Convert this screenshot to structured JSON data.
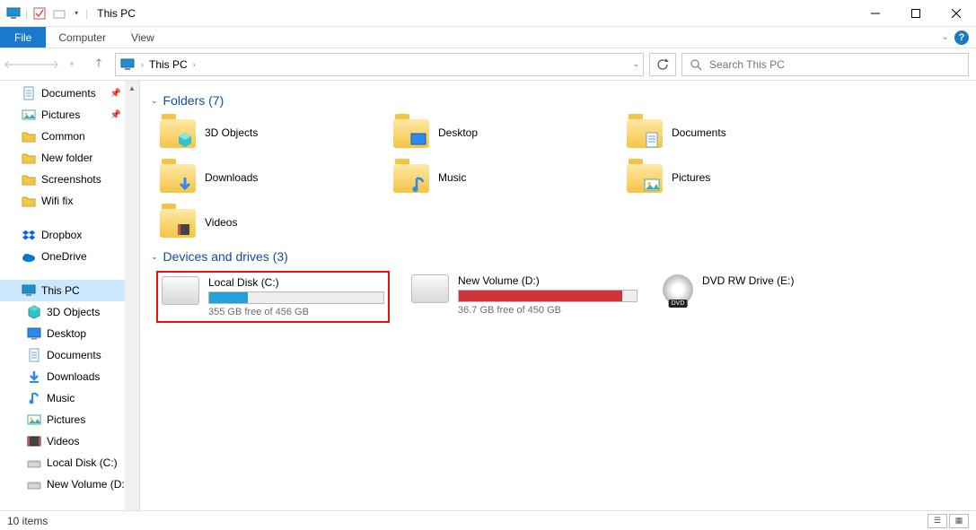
{
  "window": {
    "title": "This PC"
  },
  "ribbon": {
    "file": "File",
    "tabs": [
      "Computer",
      "View"
    ]
  },
  "address": {
    "location": "This PC"
  },
  "search": {
    "placeholder": "Search This PC"
  },
  "sidebar": {
    "quick": [
      {
        "label": "Documents",
        "pinned": true
      },
      {
        "label": "Pictures",
        "pinned": true
      },
      {
        "label": "Common",
        "pinned": false
      },
      {
        "label": "New folder",
        "pinned": false
      },
      {
        "label": "Screenshots",
        "pinned": false
      },
      {
        "label": "Wifi fix",
        "pinned": false
      }
    ],
    "cloud": [
      {
        "label": "Dropbox",
        "icon": "dropbox"
      },
      {
        "label": "OneDrive",
        "icon": "onedrive"
      }
    ],
    "thispc": {
      "label": "This PC"
    },
    "thispc_children": [
      "3D Objects",
      "Desktop",
      "Documents",
      "Downloads",
      "Music",
      "Pictures",
      "Videos",
      "Local Disk (C:)",
      "New Volume (D:"
    ]
  },
  "sections": {
    "folders_header": "Folders (7)",
    "drives_header": "Devices and drives (3)"
  },
  "folders": [
    {
      "label": "3D Objects",
      "overlay": "cube"
    },
    {
      "label": "Desktop",
      "overlay": "desktop"
    },
    {
      "label": "Documents",
      "overlay": "doc"
    },
    {
      "label": "Downloads",
      "overlay": "down"
    },
    {
      "label": "Music",
      "overlay": "music"
    },
    {
      "label": "Pictures",
      "overlay": "pic"
    },
    {
      "label": "Videos",
      "overlay": "vid"
    }
  ],
  "drives": [
    {
      "label": "Local Disk (C:)",
      "free": "355 GB free of 456 GB",
      "fill_pct": 22,
      "color": "blue",
      "highlight": true
    },
    {
      "label": "New Volume (D:)",
      "free": "36.7 GB free of 450 GB",
      "fill_pct": 92,
      "color": "red",
      "highlight": false
    },
    {
      "label": "DVD RW Drive (E:)",
      "free": "",
      "fill_pct": null,
      "color": "",
      "highlight": false,
      "dvd": true
    }
  ],
  "status": {
    "text": "10 items"
  }
}
